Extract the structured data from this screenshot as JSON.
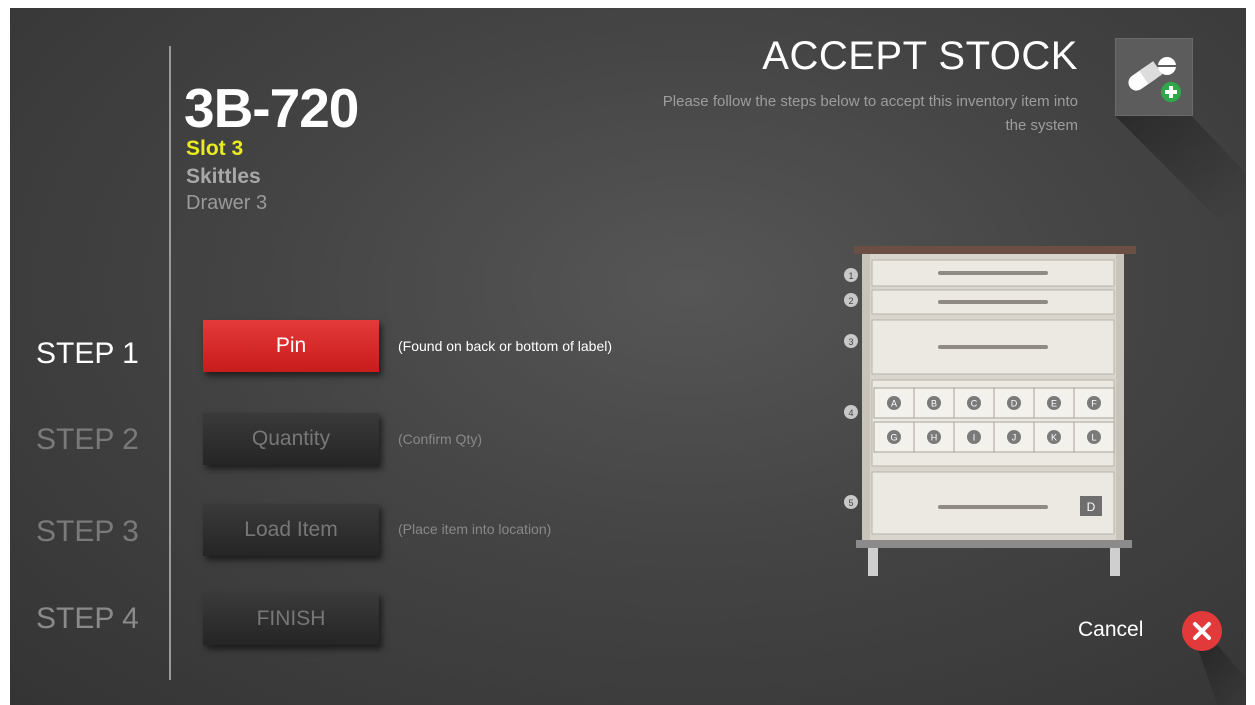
{
  "header": {
    "title": "ACCEPT STOCK",
    "subtitle": "Please follow the steps below to accept this inventory item into the system"
  },
  "item": {
    "id": "3B-720",
    "slot": "Slot 3",
    "product": "Skittles",
    "drawer": "Drawer 3"
  },
  "steps": [
    {
      "label": "STEP 1",
      "button": "Pin",
      "note": "(Found on back or bottom of label)",
      "state": "active"
    },
    {
      "label": "STEP 2",
      "button": "Quantity",
      "note": "(Confirm Qty)",
      "state": "inactive"
    },
    {
      "label": "STEP 3",
      "button": "Load Item",
      "note": "(Place item into location)",
      "state": "inactive"
    },
    {
      "label": "STEP 4",
      "button": "FINISH",
      "note": "",
      "state": "inactive"
    }
  ],
  "cabinet": {
    "drawer_numbers": [
      "1",
      "2",
      "3",
      "4",
      "5"
    ],
    "bin_row_1": [
      "A",
      "B",
      "C",
      "D",
      "E",
      "F"
    ],
    "bin_row_2": [
      "G",
      "H",
      "I",
      "J",
      "K",
      "L"
    ],
    "drawer_tag": "D"
  },
  "cancel": {
    "label": "Cancel"
  },
  "colors": {
    "accent_red": "#d42525",
    "slot_yellow": "#e9ec1f",
    "background": "#444444"
  },
  "icons": {
    "header": "pill-add-icon",
    "cancel": "close-icon"
  }
}
